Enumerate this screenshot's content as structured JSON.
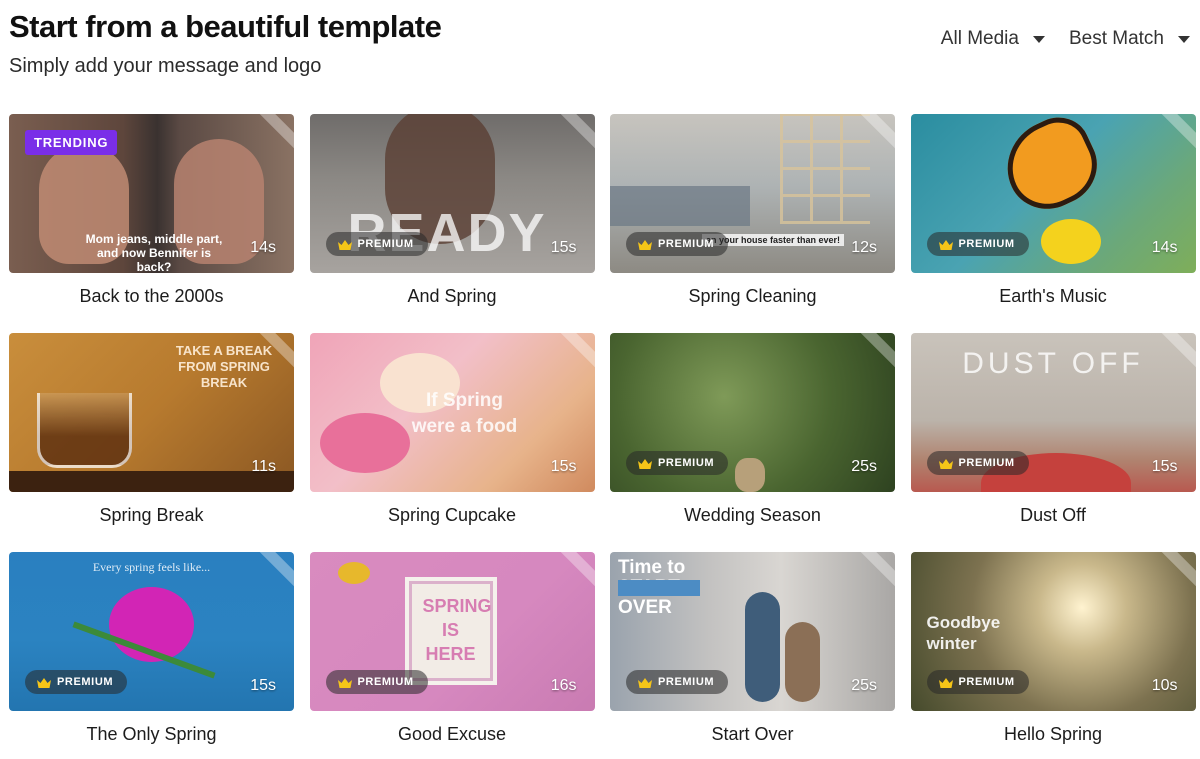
{
  "header": {
    "title": "Start from a beautiful template",
    "subtitle": "Simply add your message and logo"
  },
  "filters": {
    "media": "All Media",
    "sort": "Best Match"
  },
  "badges": {
    "trending": "TRENDING",
    "premium": "PREMIUM"
  },
  "templates": [
    {
      "title": "Back to the 2000s",
      "duration": "14s",
      "trending": true,
      "premium": false,
      "overlay": "Mom jeans, middle part, and now Bennifer is back?"
    },
    {
      "title": "And Spring",
      "duration": "15s",
      "trending": false,
      "premium": true,
      "overlay": "READY"
    },
    {
      "title": "Spring Cleaning",
      "duration": "12s",
      "trending": false,
      "premium": true,
      "overlay": "an your house faster than ever!"
    },
    {
      "title": "Earth's Music",
      "duration": "14s",
      "trending": false,
      "premium": true,
      "overlay": ""
    },
    {
      "title": "Spring Break",
      "duration": "11s",
      "trending": false,
      "premium": false,
      "overlay": "TAKE A BREAK FROM SPRING BREAK"
    },
    {
      "title": "Spring Cupcake",
      "duration": "15s",
      "trending": false,
      "premium": false,
      "overlay": "If Spring were a food"
    },
    {
      "title": "Wedding Season",
      "duration": "25s",
      "trending": false,
      "premium": true,
      "overlay": ""
    },
    {
      "title": "Dust Off",
      "duration": "15s",
      "trending": false,
      "premium": true,
      "overlay": "DUST OFF"
    },
    {
      "title": "The Only Spring",
      "duration": "15s",
      "trending": false,
      "premium": true,
      "overlay": "Every spring feels like..."
    },
    {
      "title": "Good Excuse",
      "duration": "16s",
      "trending": false,
      "premium": true,
      "overlay": "SPRING IS HERE"
    },
    {
      "title": "Start Over",
      "duration": "25s",
      "trending": false,
      "premium": true,
      "overlay": "Time to START OVER"
    },
    {
      "title": "Hello Spring",
      "duration": "10s",
      "trending": false,
      "premium": true,
      "overlay": "Goodbye winter"
    }
  ],
  "colors": {
    "trending_badge": "#7a2ee8",
    "premium_badge": "#282828",
    "crown": "#f5c518"
  },
  "icons": {
    "filter_caret": "caret-down-icon",
    "premium_crown": "crown-icon"
  }
}
